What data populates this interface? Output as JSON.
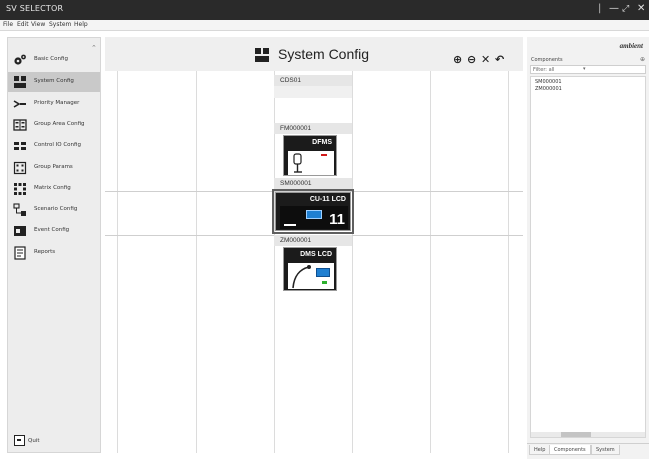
{
  "window": {
    "title": "SV SELECTOR",
    "controls": {
      "separator": "|",
      "minimize": "—",
      "maximize": "⤢",
      "close": "✕"
    }
  },
  "menu": [
    "File",
    "Edit",
    "View",
    "System",
    "Help"
  ],
  "sidebar": {
    "collapse_glyph": "⌃",
    "items": [
      {
        "label": "Basic Config",
        "icon": "gears-icon",
        "active": false
      },
      {
        "label": "System Config",
        "icon": "system-config-icon",
        "active": true
      },
      {
        "label": "Priority Manager",
        "icon": "priority-icon",
        "active": false
      },
      {
        "label": "Group Area Config",
        "icon": "group-area-icon",
        "active": false
      },
      {
        "label": "Control IO Config",
        "icon": "control-io-icon",
        "active": false
      },
      {
        "label": "Group Params",
        "icon": "group-params-icon",
        "active": false
      },
      {
        "label": "Matrix Config",
        "icon": "matrix-icon",
        "active": false
      },
      {
        "label": "Scenario Config",
        "icon": "scenario-icon",
        "active": false
      },
      {
        "label": "Event Config",
        "icon": "event-icon",
        "active": false
      },
      {
        "label": "Reports",
        "icon": "reports-icon",
        "active": false
      }
    ],
    "quit_label": "Quit"
  },
  "header": {
    "title": "System Config",
    "tools": {
      "zoom_in": "⊕",
      "zoom_out": "⊖",
      "close": "✕",
      "undo": "↶"
    }
  },
  "canvas": {
    "nodes": [
      {
        "label": "CDS01"
      },
      {
        "label": "FM000001",
        "device": "DFMS"
      },
      {
        "label": "SM000001",
        "device": "CU-11 LCD",
        "digits": "11",
        "selected": true
      },
      {
        "label": "ZM000001",
        "device": "DMS LCD"
      }
    ]
  },
  "panel": {
    "logo": "ambient",
    "title": "Components",
    "pin_glyph": "⊕",
    "filter_label": "Filter: all",
    "filter_arrow": "▾",
    "tree": [
      "SM000001",
      "ZM000001"
    ],
    "tabs": [
      "Help",
      "Components",
      "System"
    ]
  }
}
